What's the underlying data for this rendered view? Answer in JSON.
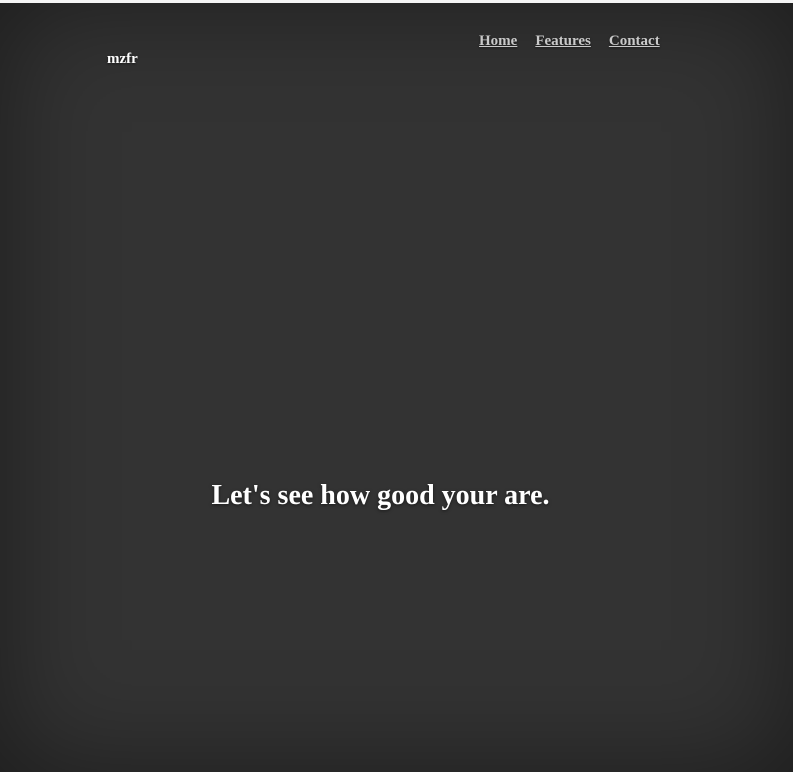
{
  "header": {
    "logo": "mzfr",
    "nav": [
      {
        "label": "Home"
      },
      {
        "label": "Features"
      },
      {
        "label": "Contact"
      }
    ]
  },
  "main": {
    "headline": "Let's see how good your are."
  },
  "colors": {
    "background": "#333333",
    "text": "#ffffff",
    "nav_link": "#c9c9c9"
  }
}
